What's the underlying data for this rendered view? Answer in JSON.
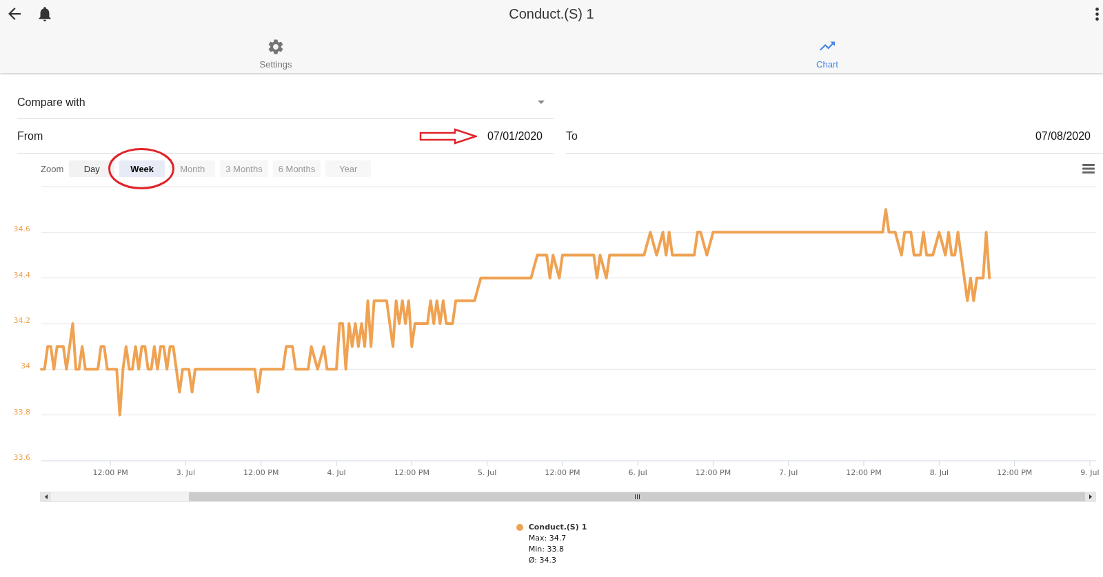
{
  "header": {
    "title": "Conduct.(S) 1"
  },
  "tabs": [
    {
      "label": "Settings",
      "kind": "settings",
      "selected": false
    },
    {
      "label": "Chart",
      "kind": "chart",
      "selected": true
    }
  ],
  "compare": {
    "label": "Compare with"
  },
  "range": [
    {
      "label": "From",
      "value": "07/01/2020"
    },
    {
      "label": "To",
      "value": "07/08/2020"
    }
  ],
  "zoom": {
    "label": "Zoom",
    "buttons": [
      {
        "label": "Day",
        "selected": false,
        "disabled": false
      },
      {
        "label": "Week",
        "selected": true,
        "disabled": false
      },
      {
        "label": "Month",
        "selected": false,
        "disabled": true
      },
      {
        "label": "3 Months",
        "selected": false,
        "disabled": true
      },
      {
        "label": "6 Months",
        "selected": false,
        "disabled": true
      },
      {
        "label": "Year",
        "selected": false,
        "disabled": true
      }
    ]
  },
  "chart": {
    "chart_data": {
      "type": "line",
      "grid": true,
      "categories": [
        null,
        null,
        null,
        null,
        null,
        null,
        null,
        null,
        null,
        null,
        null,
        null,
        null,
        null,
        null,
        null,
        null,
        null,
        null,
        null,
        null,
        null,
        "12:00 PM",
        null,
        null,
        null,
        null,
        null,
        null,
        null,
        null,
        null,
        null,
        null,
        null,
        null,
        null,
        null,
        null,
        null,
        null,
        null,
        null,
        null,
        null,
        null,
        "3. Jul",
        null,
        null,
        null,
        null,
        null,
        null,
        null,
        null,
        null,
        null,
        null,
        null,
        null,
        null,
        null,
        null,
        null,
        null,
        null,
        null,
        null,
        null,
        null,
        "12:00 PM",
        null,
        null,
        null,
        null,
        null,
        null,
        null,
        null,
        null,
        null,
        null,
        null,
        null,
        null,
        null,
        null,
        null,
        null,
        null,
        null,
        null,
        null,
        null,
        "4. Jul",
        null,
        null,
        null,
        null,
        null,
        null,
        null,
        null,
        null,
        null,
        null,
        null,
        null,
        null,
        null,
        null,
        null,
        null,
        null,
        null,
        null,
        null,
        null,
        "12:00 PM",
        null,
        null,
        null,
        null,
        null,
        null,
        null,
        null,
        null,
        null,
        null,
        null,
        null,
        null,
        null,
        null,
        null,
        null,
        null,
        null,
        null,
        null,
        null,
        "5. Jul",
        null,
        null,
        null,
        null,
        null,
        null,
        null,
        null,
        null,
        null,
        null,
        null,
        null,
        null,
        null,
        null,
        null,
        null,
        null,
        null,
        null,
        null,
        null,
        "12:00 PM",
        null,
        null,
        null,
        null,
        null,
        null,
        null,
        null,
        null,
        null,
        null,
        null,
        null,
        null,
        null,
        null,
        null,
        null,
        null,
        null,
        null,
        null,
        null,
        "6. Jul",
        null,
        null,
        null,
        null,
        null,
        null,
        null,
        null,
        null,
        null,
        null,
        null,
        null,
        null,
        null,
        null,
        null,
        null,
        null,
        null,
        null,
        null,
        null,
        "12:00 PM",
        null,
        null,
        null,
        null,
        null,
        null,
        null,
        null,
        null,
        null,
        null,
        null,
        null,
        null,
        null,
        null,
        null,
        null,
        null,
        null,
        null,
        null,
        null,
        "7. Jul",
        null,
        null,
        null,
        null,
        null,
        null,
        null,
        null,
        null,
        null,
        null,
        null,
        null,
        null,
        null,
        null,
        null,
        null,
        null,
        null,
        null,
        null,
        null,
        "12:00 PM",
        null,
        null,
        null,
        null,
        null,
        null,
        null,
        null,
        null,
        null,
        null,
        null,
        null,
        null,
        null,
        null,
        null,
        null,
        null,
        null,
        null,
        null,
        null,
        "8. Jul",
        null,
        null,
        null,
        null,
        null,
        null,
        null,
        null,
        null,
        null,
        null,
        null,
        null,
        null,
        null,
        null,
        null,
        null,
        null,
        null,
        null,
        null,
        null,
        "12:00 PM",
        null,
        null,
        null,
        null,
        null,
        null,
        null,
        null,
        null,
        null,
        null,
        null,
        null,
        null,
        null,
        null,
        null,
        null,
        null,
        null,
        null,
        null,
        null,
        "9. Jul",
        null,
        null
      ],
      "series": [
        {
          "name": "Conduct.(S) 1",
          "color": "#efa252",
          "values": [
            34,
            34,
            34.1,
            34.1,
            34,
            34.1,
            34.1,
            34.1,
            34,
            34.1,
            34.2,
            34,
            34,
            34.1,
            34,
            34,
            34,
            34,
            34,
            34.1,
            34.1,
            34,
            34,
            34,
            34,
            33.8,
            34,
            34.1,
            34,
            34,
            34.1,
            34,
            34.1,
            34.1,
            34,
            34,
            34.1,
            34,
            34.1,
            34.1,
            34,
            34.1,
            34.1,
            34,
            33.9,
            34,
            34,
            34,
            33.9,
            34,
            34,
            34,
            34,
            34,
            34,
            34,
            34,
            34,
            34,
            34,
            34,
            34,
            34,
            34,
            34,
            34,
            34,
            34,
            34,
            33.9,
            34,
            34,
            34,
            34,
            34,
            34,
            34,
            34,
            34.1,
            34.1,
            34.1,
            34,
            34,
            34,
            34,
            34,
            34.1,
            34.05,
            34,
            34.05,
            34.1,
            34,
            34,
            34,
            34,
            34.2,
            34.2,
            34,
            34.2,
            34.1,
            34.2,
            34.1,
            34.2,
            34.1,
            34.3,
            34.1,
            34.3,
            34.3,
            34.3,
            34.3,
            34.3,
            34.2,
            34.1,
            34.3,
            34.2,
            34.3,
            34.2,
            34.3,
            34.1,
            34.2,
            34.2,
            34.2,
            34.2,
            34.2,
            34.3,
            34.2,
            34.3,
            34.2,
            34.3,
            34.2,
            34.2,
            34.2,
            34.3,
            34.3,
            34.3,
            34.3,
            34.3,
            34.3,
            34.3,
            34.35,
            34.4,
            34.4,
            34.4,
            34.4,
            34.4,
            34.4,
            34.4,
            34.4,
            34.4,
            34.4,
            34.4,
            34.4,
            34.4,
            34.4,
            34.4,
            34.4,
            34.4,
            34.45,
            34.5,
            34.5,
            34.5,
            34.5,
            34.4,
            34.5,
            34.45,
            34.4,
            34.5,
            34.5,
            34.5,
            34.5,
            34.5,
            34.5,
            34.5,
            34.5,
            34.5,
            34.5,
            34.5,
            34.4,
            34.5,
            34.45,
            34.4,
            34.5,
            34.5,
            34.5,
            34.5,
            34.5,
            34.5,
            34.5,
            34.5,
            34.5,
            34.5,
            34.5,
            34.5,
            34.55,
            34.6,
            34.55,
            34.5,
            34.55,
            34.6,
            34.5,
            34.6,
            34.5,
            34.5,
            34.5,
            34.5,
            34.5,
            34.5,
            34.5,
            34.5,
            34.6,
            34.6,
            34.55,
            34.5,
            34.55,
            34.6,
            34.6,
            34.6,
            34.6,
            34.6,
            34.6,
            34.6,
            34.6,
            34.6,
            34.6,
            34.6,
            34.6,
            34.6,
            34.6,
            34.6,
            34.6,
            34.6,
            34.6,
            34.6,
            34.6,
            34.6,
            34.6,
            34.6,
            34.6,
            34.6,
            34.6,
            34.6,
            34.6,
            34.6,
            34.6,
            34.6,
            34.6,
            34.6,
            34.6,
            34.6,
            34.6,
            34.6,
            34.6,
            34.6,
            34.6,
            34.6,
            34.6,
            34.6,
            34.6,
            34.6,
            34.6,
            34.6,
            34.6,
            34.6,
            34.6,
            34.6,
            34.6,
            34.6,
            34.6,
            34.6,
            34.7,
            34.6,
            34.6,
            34.6,
            34.55,
            34.5,
            34.6,
            34.6,
            34.6,
            34.5,
            34.5,
            34.5,
            34.6,
            34.5,
            34.5,
            34.5,
            34.55,
            34.6,
            34.55,
            34.5,
            34.6,
            34.5,
            34.5,
            34.6,
            34.5,
            34.4,
            34.3,
            34.4,
            34.3,
            34.4,
            34.4,
            34.4,
            34.6,
            34.4,
            null,
            null,
            null,
            null,
            null,
            null,
            null,
            null,
            null,
            null,
            null,
            null,
            null,
            null,
            null,
            null,
            null,
            null,
            null,
            null,
            null,
            null,
            null,
            null,
            null,
            null,
            null,
            null,
            null,
            null,
            null,
            null,
            null,
            null
          ]
        }
      ],
      "ylim": [
        33.6,
        34.8
      ],
      "yticks": [
        33.6,
        33.8,
        34,
        34.2,
        34.4,
        34.6
      ]
    },
    "legend_stats": [
      "Max: 34.7",
      "Min: 33.8",
      "Ø: 34.3"
    ]
  }
}
